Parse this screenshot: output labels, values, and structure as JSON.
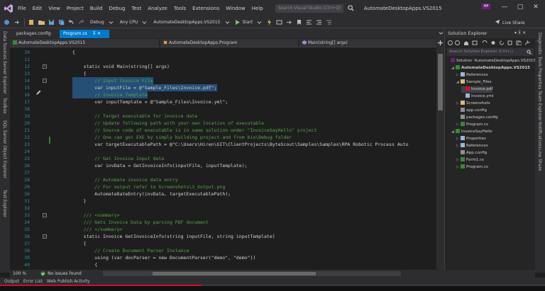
{
  "titlebar": {
    "menu": [
      "File",
      "Edit",
      "View",
      "Project",
      "Build",
      "Debug",
      "Test",
      "Analyze",
      "Tools",
      "Extensions",
      "Window",
      "Help"
    ],
    "quick_launch_placeholder": "Search Visual Studio (Ctrl+Q)",
    "solution_name": "AutomateDesktopApps.VS2015",
    "user_initials": "HP",
    "minimize": "—",
    "maximize": "▢",
    "close": "✕"
  },
  "toolbar": {
    "config": "Debug",
    "platform": "Any CPU",
    "startup_project": "AutomateDesktopApps.VS2015",
    "start": "Start",
    "live_share": "Live Share"
  },
  "left_tabs": [
    "Data Sources",
    "Server Explorer",
    "Toolbox",
    "SQL Server Object Explorer",
    "Test Explorer"
  ],
  "doc_tabs": {
    "packages": "packages.config",
    "program": "Program.cs",
    "program_pin": "⊼",
    "program_close": "✕"
  },
  "navbar": {
    "project": "AutomateDesktopApps.VS2015",
    "class": "AutomateDesktopApps.Program",
    "member": "Main(string[] args)"
  },
  "code_lines": [
    {
      "n": "10",
      "t": "{"
    },
    {
      "n": "11",
      "t": ""
    },
    {
      "n": "12",
      "t": "    static void Main(string[] args)"
    },
    {
      "n": "13",
      "t": "    {"
    },
    {
      "n": "14",
      "t": "        // Input Invoice File"
    },
    {
      "n": "15",
      "t": "        var inputFile = @\"Sample_Files\\Invoice.pdf\";"
    },
    {
      "n": "16",
      "t": "        // Invoice Template"
    },
    {
      "n": "17",
      "t": "        var inputTemplate = @\"Sample_Files\\Invoice.yml\";"
    },
    {
      "n": "18",
      "t": ""
    },
    {
      "n": "19",
      "t": "        // Target executable for invoice data"
    },
    {
      "n": "20",
      "t": "        // Update following path with your own location of executable"
    },
    {
      "n": "21",
      "t": "        // Source code of executable is in same solution under \"InvoiceSayHello\" project"
    },
    {
      "n": "22",
      "t": "        // One can get EXE by simply building project and from bin\\Debug folder"
    },
    {
      "n": "23",
      "t": "        var targetExecutablePath = @\"C:\\Users\\Hiren\\GIT\\ClientProjects\\ByteScout\\Samples\\Samples\\RPA Robotic Process Auto"
    },
    {
      "n": "24",
      "t": ""
    },
    {
      "n": "25",
      "t": "        // Get Invoice Input data"
    },
    {
      "n": "26",
      "t": "        var invData = GetInvoiceInfo(inputFile, inputTemplate);"
    },
    {
      "n": "27",
      "t": ""
    },
    {
      "n": "28",
      "t": "        // Automate invoice data entry"
    },
    {
      "n": "29",
      "t": "        // For output refer to Screenshots\\3_Output.png"
    },
    {
      "n": "30",
      "t": "        AutomateDateEntry(invData, targetExecutablePath);"
    },
    {
      "n": "31",
      "t": "    }"
    },
    {
      "n": "32",
      "t": ""
    },
    {
      "n": "33",
      "t": "    /// <summary>"
    },
    {
      "n": "34",
      "t": "    /// Gets Invoice Data by parsing PDF document"
    },
    {
      "n": "35",
      "t": "    /// </summary>"
    },
    {
      "n": "36",
      "t": "    static Invoice GetInvoiceInfo(string inputFile, string inputTemplate)"
    },
    {
      "n": "37",
      "t": "    {"
    },
    {
      "n": "38",
      "t": "        // Create Document Parser Instance"
    },
    {
      "n": "39",
      "t": "        using (var docParser = new DocumentParser(\"demo\", \"demo\"))"
    },
    {
      "n": "40",
      "t": "        {"
    }
  ],
  "solution_explorer": {
    "title": "Solution Explorer",
    "title_buttons": "▾ ⊼ ✕",
    "search_placeholder": "Search Solution Explorer (Ctrl+;)",
    "items": [
      {
        "label": "Solution 'AutomateDesktopApps.VS2015'",
        "indent": 0,
        "arrow": "",
        "bold": false,
        "selected": false
      },
      {
        "label": "AutomateDesktopApps.VS2015",
        "indent": 1,
        "arrow": "◢",
        "bold": true,
        "selected": false
      },
      {
        "label": "References",
        "indent": 2,
        "arrow": "▷",
        "bold": false,
        "selected": false
      },
      {
        "label": "Sample_Files",
        "indent": 2,
        "arrow": "◢",
        "bold": false,
        "selected": false
      },
      {
        "label": "Invoice.pdf",
        "indent": 3,
        "arrow": "",
        "bold": false,
        "selected": true
      },
      {
        "label": "Invoice.yml",
        "indent": 3,
        "arrow": "",
        "bold": false,
        "selected": false
      },
      {
        "label": "Screenshots",
        "indent": 2,
        "arrow": "▷",
        "bold": false,
        "selected": false
      },
      {
        "label": "app.config",
        "indent": 2,
        "arrow": "",
        "bold": false,
        "selected": false
      },
      {
        "label": "packages.config",
        "indent": 2,
        "arrow": "",
        "bold": false,
        "selected": false
      },
      {
        "label": "Program.cs",
        "indent": 2,
        "arrow": "▷",
        "bold": false,
        "selected": false
      },
      {
        "label": "InvoiceSayHello",
        "indent": 1,
        "arrow": "◢",
        "bold": false,
        "selected": false
      },
      {
        "label": "Properties",
        "indent": 2,
        "arrow": "▷",
        "bold": false,
        "selected": false
      },
      {
        "label": "References",
        "indent": 2,
        "arrow": "▷",
        "bold": false,
        "selected": false
      },
      {
        "label": "App.config",
        "indent": 2,
        "arrow": "",
        "bold": false,
        "selected": false
      },
      {
        "label": "Form1.cs",
        "indent": 2,
        "arrow": "▷",
        "bold": false,
        "selected": false
      },
      {
        "label": "Program.cs",
        "indent": 2,
        "arrow": "▷",
        "bold": false,
        "selected": false
      }
    ]
  },
  "right_tabs": [
    "Diagnostic Tools",
    "Properties",
    "Team Explorer",
    "Notifications",
    "Live Share"
  ],
  "status": {
    "zoom": "100 %",
    "issues": "No issues found"
  },
  "bottom_tabs": [
    "Output",
    "Error List",
    "Web Publish Activity"
  ],
  "progress": {
    "value": 0.37,
    "color": "#c8102e"
  }
}
